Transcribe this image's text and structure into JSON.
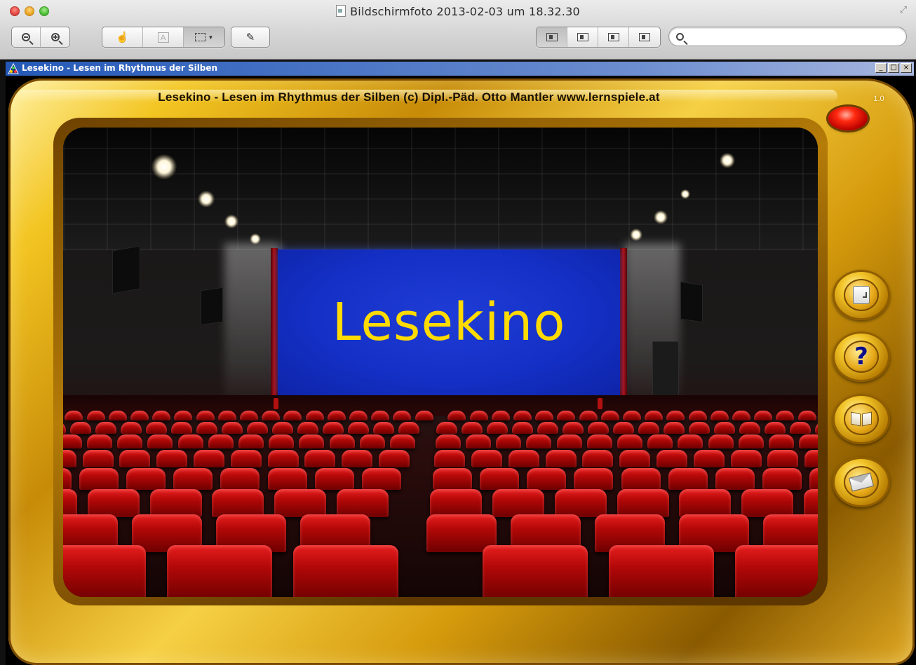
{
  "preview_window": {
    "title": "Bildschirmfoto 2013-02-03 um 18.32.30",
    "search": {
      "value": "",
      "placeholder": ""
    },
    "toolbar": {
      "zoom_group": [
        "zoom-out-icon",
        "zoom-in-icon"
      ],
      "tools_group": [
        "hand-icon",
        "text-select-icon",
        "rect-select-icon"
      ],
      "annotate_group": [
        "pencil-icon"
      ],
      "view_group": [
        "content-only-icon",
        "thumbnails-icon",
        "table-of-contents-icon",
        "contact-sheet-icon"
      ]
    }
  },
  "app_window": {
    "title": "Lesekino - Lesen im Rhythmus der Silben",
    "controls": {
      "minimize": "_",
      "maximize": "□",
      "close": "×"
    }
  },
  "app": {
    "header": "Lesekino - Lesen im Rhythmus der Silben  (c) Dipl.-Päd. Otto Mantler  www.lernspiele.at",
    "version": "1.0",
    "screen_title": "Lesekino",
    "side_buttons": [
      {
        "name": "exit-button",
        "icon": "exit-icon"
      },
      {
        "name": "help-button",
        "icon": "help-icon",
        "glyph": "?"
      },
      {
        "name": "book-button",
        "icon": "book-icon"
      },
      {
        "name": "mail-button",
        "icon": "mail-icon"
      }
    ]
  },
  "colors": {
    "screen_blue": "#1430c6",
    "logo_yellow": "#ffdb00",
    "frame_gold": "#f3c522",
    "seat_red": "#c10a0a",
    "titlebar_blue": "#2459b8"
  }
}
